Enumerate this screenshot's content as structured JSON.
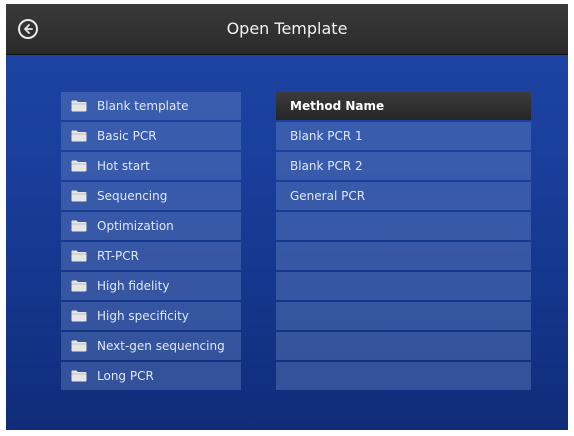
{
  "header": {
    "title": "Open Template",
    "back_icon": "back-arrow-circle-icon"
  },
  "folders": [
    {
      "label": "Blank template",
      "icon": "folder-icon"
    },
    {
      "label": "Basic PCR",
      "icon": "folder-icon"
    },
    {
      "label": "Hot start",
      "icon": "folder-icon"
    },
    {
      "label": "Sequencing",
      "icon": "folder-icon"
    },
    {
      "label": "Optimization",
      "icon": "folder-icon"
    },
    {
      "label": "RT-PCR",
      "icon": "folder-icon"
    },
    {
      "label": "High fidelity",
      "icon": "folder-icon"
    },
    {
      "label": "High specificity",
      "icon": "folder-icon"
    },
    {
      "label": "Next-gen sequencing",
      "icon": "folder-icon"
    },
    {
      "label": "Long PCR",
      "icon": "folder-icon"
    }
  ],
  "methods": {
    "header": "Method Name",
    "rows": [
      "Blank PCR 1",
      "Blank PCR 2",
      "General PCR",
      "",
      "",
      "",
      "",
      "",
      ""
    ]
  },
  "colors": {
    "background": "#1a3f9c",
    "titlebar": "#2e2e2e",
    "row": "#4a6cb8",
    "text": "#dfe8f8"
  }
}
